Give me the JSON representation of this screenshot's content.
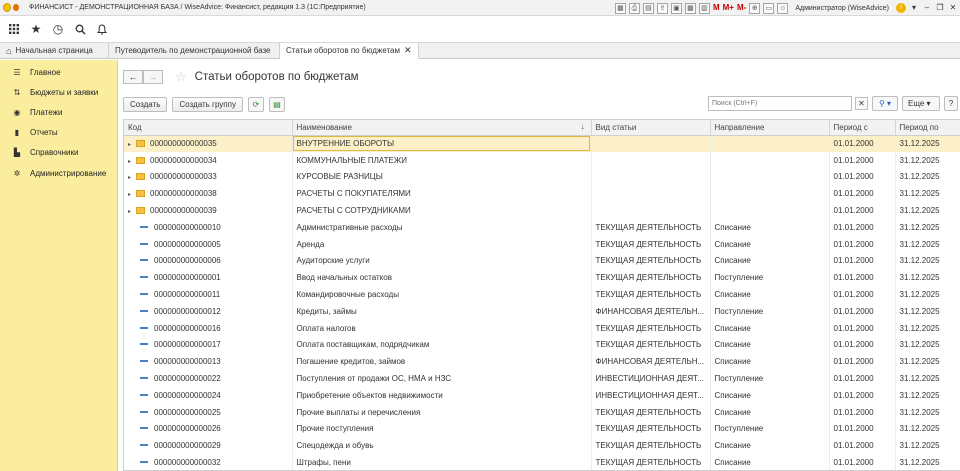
{
  "window": {
    "title": "ФИНАНСИСТ - ДЕМОНСТРАЦИОННАЯ БАЗА / WiseAdvice: Финансист, редакция 1.3 (1С:Предприятие)",
    "user": "Администратор (WiseAdvice)",
    "m_labels": [
      "M",
      "M+",
      "M-"
    ]
  },
  "tabs": [
    {
      "label": "Начальная страница"
    },
    {
      "label": "Путеводитель по демонстрационной базе"
    },
    {
      "label": "Статьи оборотов по бюджетам"
    }
  ],
  "sidebar": {
    "items": [
      {
        "label": "Главное",
        "icon": "menu-icon"
      },
      {
        "label": "Бюджеты и заявки",
        "icon": "budget-icon"
      },
      {
        "label": "Платежи",
        "icon": "payments-icon"
      },
      {
        "label": "Отчеты",
        "icon": "reports-icon"
      },
      {
        "label": "Справочники",
        "icon": "book-icon"
      },
      {
        "label": "Администрирование",
        "icon": "gear-icon"
      }
    ]
  },
  "form": {
    "title": "Статьи оборотов по бюджетам",
    "create_label": "Создать",
    "create_group_label": "Создать группу",
    "search_placeholder": "Поиск (Ctrl+F)",
    "more_label": "Еще",
    "help_label": "?"
  },
  "table": {
    "columns": [
      "Код",
      "Наименование",
      "Вид статьи",
      "Направление",
      "Период с",
      "Период по"
    ],
    "rows": [
      {
        "type": "group",
        "code": "000000000000035",
        "name": "ВНУТРЕННИЕ ОБОРОТЫ",
        "kind": "",
        "dir": "",
        "from": "01.01.2000",
        "to": "31.12.2025"
      },
      {
        "type": "group",
        "code": "000000000000034",
        "name": "КОММУНАЛЬНЫЕ ПЛАТЕЖИ",
        "kind": "",
        "dir": "",
        "from": "01.01.2000",
        "to": "31.12.2025"
      },
      {
        "type": "group",
        "code": "000000000000033",
        "name": "КУРСОВЫЕ РАЗНИЦЫ",
        "kind": "",
        "dir": "",
        "from": "01.01.2000",
        "to": "31.12.2025"
      },
      {
        "type": "group",
        "code": "000000000000038",
        "name": "РАСЧЕТЫ С ПОКУПАТЕЛЯМИ",
        "kind": "",
        "dir": "",
        "from": "01.01.2000",
        "to": "31.12.2025"
      },
      {
        "type": "group",
        "code": "000000000000039",
        "name": "РАСЧЕТЫ С СОТРУДНИКАМИ",
        "kind": "",
        "dir": "",
        "from": "01.01.2000",
        "to": "31.12.2025"
      },
      {
        "type": "item",
        "code": "000000000000010",
        "name": "Административные расходы",
        "kind": "ТЕКУЩАЯ ДЕЯТЕЛЬНОСТЬ",
        "dir": "Списание",
        "from": "01.01.2000",
        "to": "31.12.2025"
      },
      {
        "type": "item",
        "code": "000000000000005",
        "name": "Аренда",
        "kind": "ТЕКУЩАЯ ДЕЯТЕЛЬНОСТЬ",
        "dir": "Списание",
        "from": "01.01.2000",
        "to": "31.12.2025"
      },
      {
        "type": "item",
        "code": "000000000000006",
        "name": "Аудиторские услуги",
        "kind": "ТЕКУЩАЯ ДЕЯТЕЛЬНОСТЬ",
        "dir": "Списание",
        "from": "01.01.2000",
        "to": "31.12.2025"
      },
      {
        "type": "item",
        "code": "000000000000001",
        "name": "Ввод начальных остатков",
        "kind": "ТЕКУЩАЯ ДЕЯТЕЛЬНОСТЬ",
        "dir": "Поступление",
        "from": "01.01.2000",
        "to": "31.12.2025"
      },
      {
        "type": "item",
        "code": "000000000000011",
        "name": "Командировочные расходы",
        "kind": "ТЕКУЩАЯ ДЕЯТЕЛЬНОСТЬ",
        "dir": "Списание",
        "from": "01.01.2000",
        "to": "31.12.2025"
      },
      {
        "type": "item",
        "code": "000000000000012",
        "name": "Кредиты, займы",
        "kind": "ФИНАНСОВАЯ ДЕЯТЕЛЬН...",
        "dir": "Поступление",
        "from": "01.01.2000",
        "to": "31.12.2025"
      },
      {
        "type": "item",
        "code": "000000000000016",
        "name": "Оплата налогов",
        "kind": "ТЕКУЩАЯ ДЕЯТЕЛЬНОСТЬ",
        "dir": "Списание",
        "from": "01.01.2000",
        "to": "31.12.2025"
      },
      {
        "type": "item",
        "code": "000000000000017",
        "name": "Оплата поставщикам, подрядчикам",
        "kind": "ТЕКУЩАЯ ДЕЯТЕЛЬНОСТЬ",
        "dir": "Списание",
        "from": "01.01.2000",
        "to": "31.12.2025"
      },
      {
        "type": "item",
        "code": "000000000000013",
        "name": "Погашение кредитов, займов",
        "kind": "ФИНАНСОВАЯ ДЕЯТЕЛЬН...",
        "dir": "Списание",
        "from": "01.01.2000",
        "to": "31.12.2025"
      },
      {
        "type": "item",
        "code": "000000000000022",
        "name": "Поступления от продажи ОС, НМА и НЗС",
        "kind": "ИНВЕСТИЦИОННАЯ ДЕЯТ...",
        "dir": "Поступление",
        "from": "01.01.2000",
        "to": "31.12.2025"
      },
      {
        "type": "item",
        "code": "000000000000024",
        "name": "Приобретение объектов недвижимости",
        "kind": "ИНВЕСТИЦИОННАЯ ДЕЯТ...",
        "dir": "Списание",
        "from": "01.01.2000",
        "to": "31.12.2025"
      },
      {
        "type": "item",
        "code": "000000000000025",
        "name": "Прочие выплаты и перечисления",
        "kind": "ТЕКУЩАЯ ДЕЯТЕЛЬНОСТЬ",
        "dir": "Списание",
        "from": "01.01.2000",
        "to": "31.12.2025"
      },
      {
        "type": "item",
        "code": "000000000000026",
        "name": "Прочие поступления",
        "kind": "ТЕКУЩАЯ ДЕЯТЕЛЬНОСТЬ",
        "dir": "Поступление",
        "from": "01.01.2000",
        "to": "31.12.2025"
      },
      {
        "type": "item",
        "code": "000000000000029",
        "name": "Спецодежда и обувь",
        "kind": "ТЕКУЩАЯ ДЕЯТЕЛЬНОСТЬ",
        "dir": "Списание",
        "from": "01.01.2000",
        "to": "31.12.2025"
      },
      {
        "type": "item",
        "code": "000000000000032",
        "name": "Штрафы, пени",
        "kind": "ТЕКУЩАЯ ДЕЯТЕЛЬНОСТЬ",
        "dir": "Списание",
        "from": "01.01.2000",
        "to": "31.12.2025"
      }
    ]
  },
  "colors": {
    "sidebar_bg": "#fbed9e",
    "selected_row": "#fbf0c8",
    "folder": "#f4c242",
    "item_dash": "#4a7fc0"
  }
}
